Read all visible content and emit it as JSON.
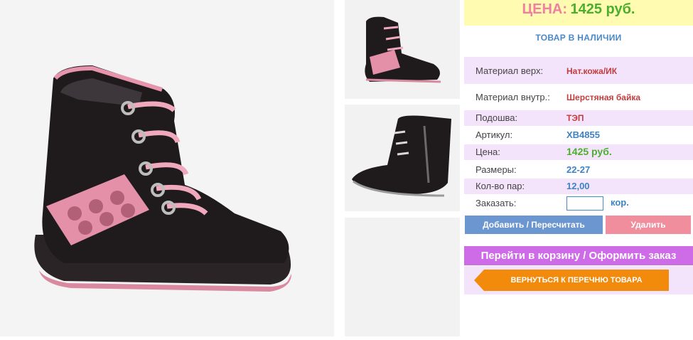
{
  "product": {
    "price_label": "ЦЕНА:",
    "price_value": "1425 руб.",
    "stock_status": "ТОВАР В НАЛИЧИИ"
  },
  "specs": [
    {
      "label": "Материал верх:",
      "value": "Нат.кожа/ИК"
    },
    {
      "label": "Материал внутр.:",
      "value": "Шерстяная байка"
    },
    {
      "label": "Подошва:",
      "value": "ТЭП"
    },
    {
      "label": "Артикул:",
      "value": "XB4855"
    },
    {
      "label": "Цена:",
      "value": "1425 руб."
    },
    {
      "label": "Размеры:",
      "value": "22-27"
    },
    {
      "label": "Кол-во пар:",
      "value": "12,00"
    }
  ],
  "order": {
    "label": "Заказать:",
    "quantity_value": "",
    "unit": "кор."
  },
  "buttons": {
    "add": "Добавить / Пересчитать",
    "delete": "Удалить",
    "cart": "Перейти в корзину / Оформить заказ",
    "back": "ВЕРНУТЬСЯ К ПЕРЕЧНЮ ТОВАРА"
  },
  "colors": {
    "accent_pink": "#f07fa3",
    "accent_green": "#4cae2f",
    "accent_blue": "#4a89c8",
    "accent_purple": "#cd6ce6",
    "accent_orange": "#f28a0c"
  }
}
